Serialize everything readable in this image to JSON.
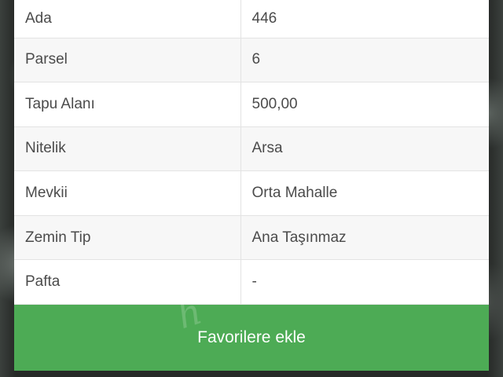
{
  "details": {
    "rows": [
      {
        "label": "Ada",
        "value": "446"
      },
      {
        "label": "Parsel",
        "value": "6"
      },
      {
        "label": "Tapu Alanı",
        "value": "500,00"
      },
      {
        "label": "Nitelik",
        "value": "Arsa"
      },
      {
        "label": "Mevkii",
        "value": "Orta Mahalle"
      },
      {
        "label": "Zemin Tip",
        "value": "Ana Taşınmaz"
      },
      {
        "label": "Pafta",
        "value": "-"
      }
    ]
  },
  "actions": {
    "favorite_label": "Favorilere ekle"
  },
  "watermark": "h",
  "colors": {
    "button": "#4dab55",
    "text": "#4b4b4b",
    "row_alt": "#f7f7f7"
  }
}
